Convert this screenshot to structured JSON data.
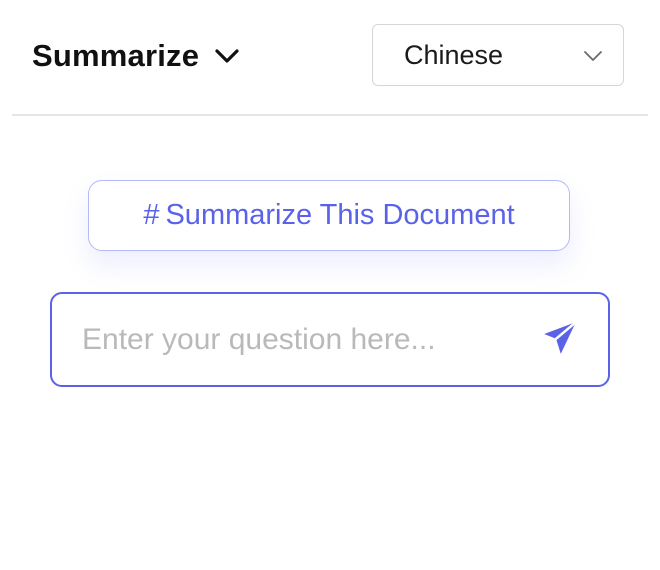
{
  "header": {
    "mode_label": "Summarize",
    "mode_icon": "chevron-down-icon",
    "language": {
      "selected": "Chinese",
      "icon": "chevron-down-icon"
    }
  },
  "main": {
    "suggestion_chip": {
      "hash": "#",
      "label": "Summarize This Document"
    },
    "question_input": {
      "value": "",
      "placeholder": "Enter your question here...",
      "send_icon": "send-paper-plane-icon"
    }
  },
  "colors": {
    "accent": "#5a62e8",
    "chip_border": "#b4baf6",
    "text_primary": "#111111",
    "placeholder": "#b9b9b9",
    "divider": "#e6e6e6",
    "select_border": "#d6d6d6"
  }
}
